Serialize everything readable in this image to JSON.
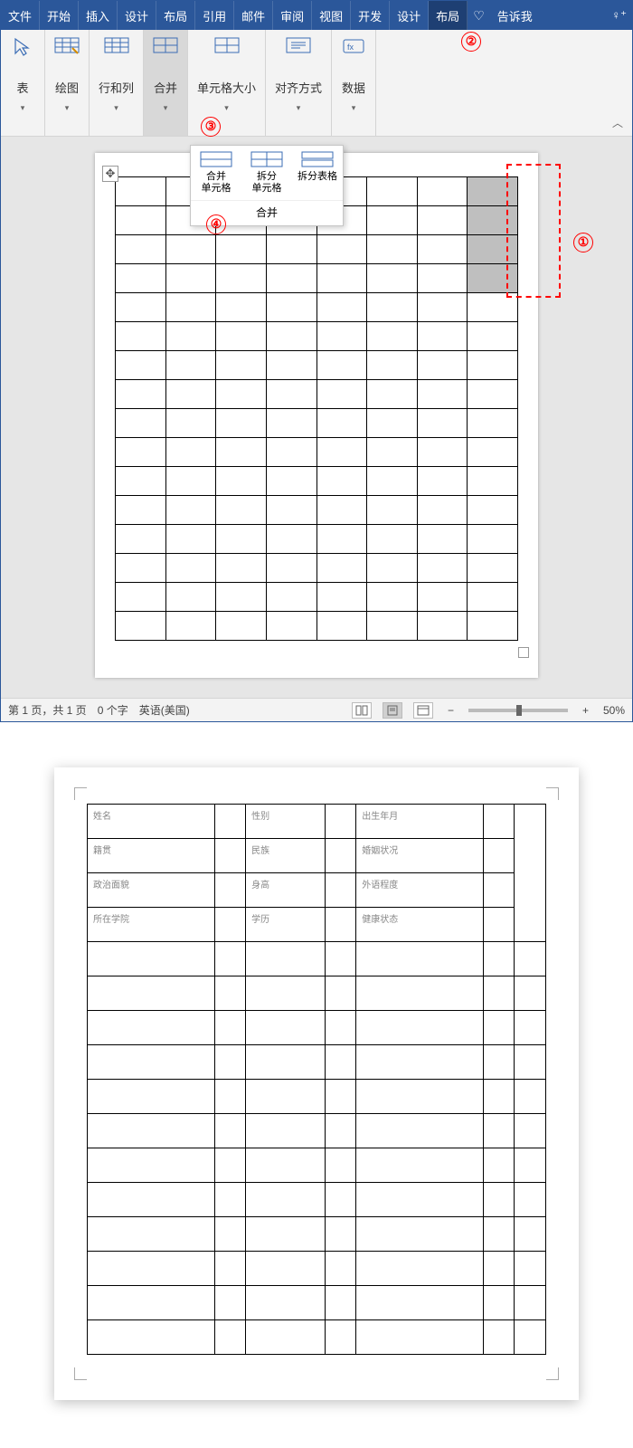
{
  "tabs": [
    "文件",
    "开始",
    "插入",
    "设计",
    "布局",
    "引用",
    "邮件",
    "审阅",
    "视图",
    "开发",
    "设计",
    "布局"
  ],
  "active_tab_index": 11,
  "tell_me": "告诉我",
  "ribbon_groups": [
    {
      "label": "表",
      "icon": "cursor"
    },
    {
      "label": "绘图",
      "icon": "pencil"
    },
    {
      "label": "行和列",
      "icon": "table"
    },
    {
      "label": "合并",
      "icon": "table",
      "active": true
    },
    {
      "label": "单元格大小",
      "icon": "table"
    },
    {
      "label": "对齐方式",
      "icon": "align"
    },
    {
      "label": "数据",
      "icon": "data"
    }
  ],
  "dropdown": {
    "items": [
      {
        "label": "合并\n单元格"
      },
      {
        "label": "拆分\n单元格"
      },
      {
        "label": "拆分表格"
      }
    ],
    "title": "合并"
  },
  "doc_table": {
    "rows": 16,
    "cols": 8,
    "selected_cells": [
      [
        0,
        7
      ],
      [
        1,
        7
      ],
      [
        2,
        7
      ],
      [
        3,
        7
      ]
    ]
  },
  "annotations": {
    "1": "①",
    "2": "②",
    "3": "③",
    "4": "④"
  },
  "status": {
    "page": "第 1 页，共 1 页",
    "words": "0 个字",
    "lang": "英语(美国)",
    "zoom": "50%"
  },
  "form": {
    "rows": [
      [
        "姓名",
        "",
        "性别",
        "",
        "出生年月",
        "",
        ""
      ],
      [
        "籍贯",
        "",
        "民族",
        "",
        "婚姻状况",
        "",
        ""
      ],
      [
        "政治面貌",
        "",
        "身高",
        "",
        "外语程度",
        "",
        ""
      ],
      [
        "所在学院",
        "",
        "学历",
        "",
        "健康状态",
        "",
        ""
      ]
    ],
    "blank_rows": 12,
    "blank_cols": 7
  }
}
